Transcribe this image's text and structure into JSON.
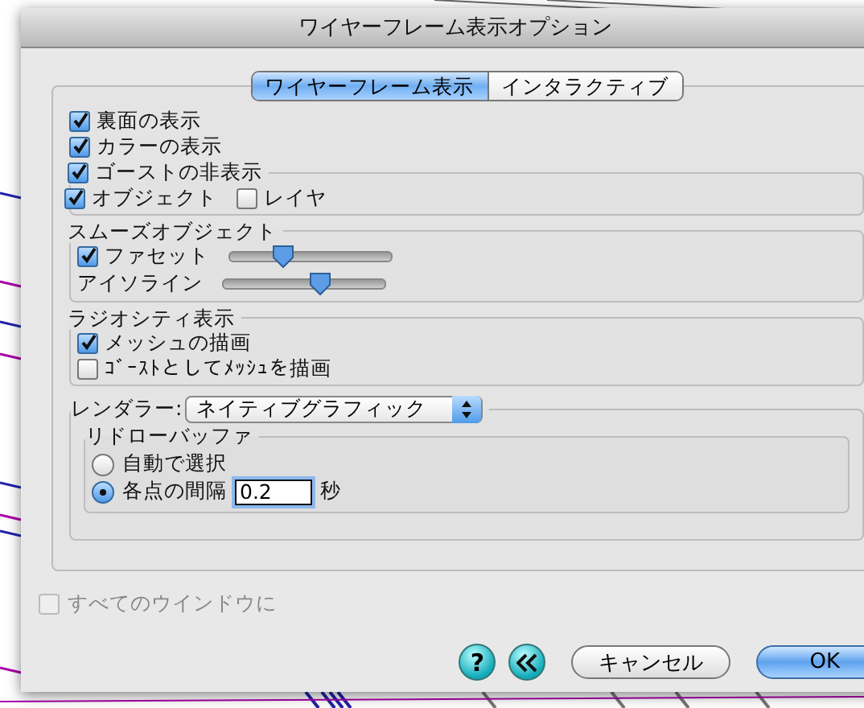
{
  "window": {
    "title": "ワイヤーフレーム表示オプション"
  },
  "tabs": [
    {
      "label": "ワイヤーフレーム表示",
      "selected": true
    },
    {
      "label": "インタラクティブ",
      "selected": false
    }
  ],
  "display_options": [
    {
      "label": "裏面の表示",
      "checked": true
    },
    {
      "label": "カラーの表示",
      "checked": true
    }
  ],
  "ghost_hide": {
    "label": "ゴーストの非表示",
    "checked": true,
    "options": [
      {
        "label": "オブジェクト",
        "checked": true
      },
      {
        "label": "レイヤ",
        "checked": false
      }
    ]
  },
  "smooth_objects": {
    "title": "スムーズオブジェクト",
    "sliders": [
      {
        "label": "ファセット",
        "kind": "checkbox",
        "checked": true,
        "level": 0.33
      },
      {
        "label": "アイソライン",
        "kind": "plain",
        "level": 0.6
      }
    ]
  },
  "radiosity": {
    "title": "ラジオシティ表示",
    "options": [
      {
        "label": "メッシュの描画",
        "checked": true
      },
      {
        "label": "ｺﾞｰｽﾄとしてﾒｯｼｭを描画",
        "checked": false
      }
    ]
  },
  "renderer": {
    "label": "レンダラー:",
    "value": "ネイティブグラフィック"
  },
  "redraw_buffer": {
    "title": "リドローバッファ",
    "options": [
      {
        "label": "自動で選択",
        "selected": false
      },
      {
        "label": "各点の間隔",
        "selected": true,
        "value": "0.2",
        "unit": "秒"
      }
    ]
  },
  "all_windows": {
    "label": "すべてのウインドウに",
    "checked": false,
    "disabled": true
  },
  "buttons": [
    {
      "kind": "help",
      "label": "?"
    },
    {
      "kind": "back"
    },
    {
      "kind": "normal",
      "label": "キャンセル"
    },
    {
      "kind": "default",
      "label": "OK"
    }
  ]
}
